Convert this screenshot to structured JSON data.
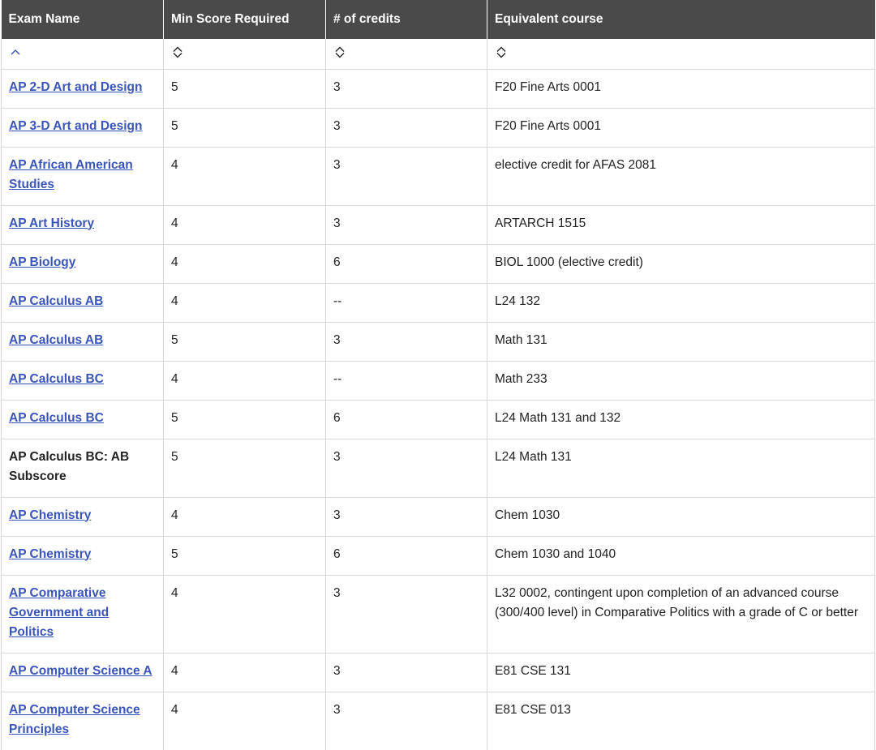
{
  "headers": {
    "exam_name": "Exam Name",
    "min_score": "Min Score Required",
    "credits": "# of credits",
    "equivalent": "Equivalent course"
  },
  "sort": {
    "exam_name": "sorted-ascending",
    "min_score": "unsorted",
    "credits": "unsorted",
    "equivalent": "unsorted"
  },
  "colors": {
    "header_bg": "#4a4a4a",
    "link": "#3a55b8",
    "border": "#d8d8d8"
  },
  "rows": [
    {
      "exam": "AP 2-D Art and Design",
      "link": true,
      "score": "5",
      "credits": "3",
      "course": "F20 Fine Arts 0001"
    },
    {
      "exam": "AP 3-D Art and Design",
      "link": true,
      "score": "5",
      "credits": "3",
      "course": "F20 Fine Arts 0001"
    },
    {
      "exam": "AP African American Studies",
      "link": true,
      "score": "4",
      "credits": "3",
      "course": "elective credit for AFAS 2081"
    },
    {
      "exam": "AP Art History",
      "link": true,
      "score": "4",
      "credits": "3",
      "course": "ARTARCH 1515"
    },
    {
      "exam": "AP Biology",
      "link": true,
      "score": "4",
      "credits": "6",
      "course": "BIOL 1000 (elective credit)"
    },
    {
      "exam": "AP Calculus AB",
      "link": true,
      "score": "4",
      "credits": "--",
      "course": "L24 132"
    },
    {
      "exam": "AP Calculus AB",
      "link": true,
      "score": "5",
      "credits": "3",
      "course": "Math 131"
    },
    {
      "exam": "AP Calculus BC",
      "link": true,
      "score": "4",
      "credits": "--",
      "course": "Math 233"
    },
    {
      "exam": "AP Calculus BC",
      "link": true,
      "score": "5",
      "credits": "6",
      "course": "L24 Math 131 and 132"
    },
    {
      "exam": "AP Calculus BC: AB Subscore",
      "link": false,
      "score": "5",
      "credits": "3",
      "course": "L24 Math 131"
    },
    {
      "exam": "AP Chemistry",
      "link": true,
      "score": "4",
      "credits": "3",
      "course": "Chem 1030"
    },
    {
      "exam": "AP Chemistry",
      "link": true,
      "score": "5",
      "credits": "6",
      "course": "Chem 1030 and 1040"
    },
    {
      "exam": "AP Comparative Government and Politics",
      "link": true,
      "score": "4",
      "credits": "3",
      "course": "L32 0002, contingent upon completion of an advanced course (300/400 level) in Comparative Politics with a grade of C or better"
    },
    {
      "exam": "AP Computer Science A",
      "link": true,
      "score": "4",
      "credits": "3",
      "course": "E81 CSE 131"
    },
    {
      "exam": "AP Computer Science Principles",
      "link": true,
      "score": "4",
      "credits": "3",
      "course": "E81 CSE 013"
    }
  ]
}
